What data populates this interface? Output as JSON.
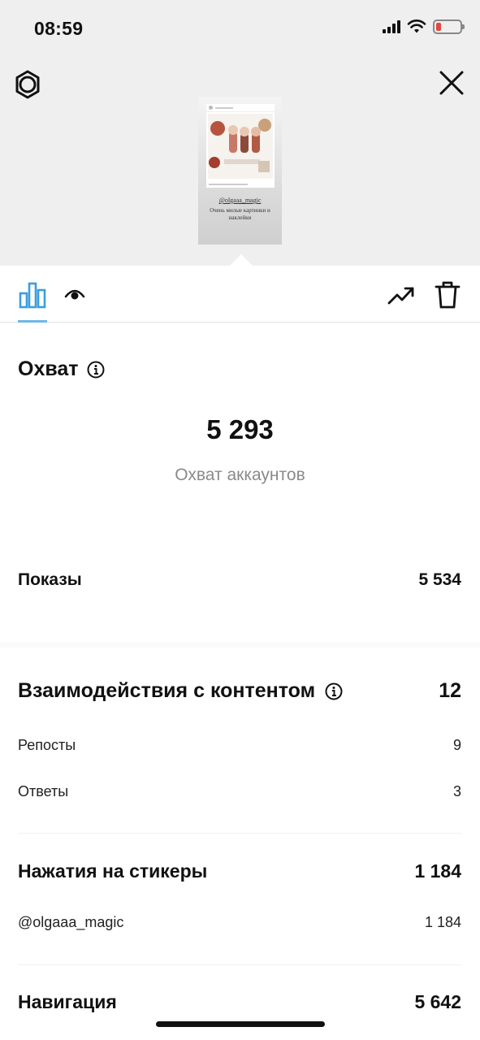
{
  "status": {
    "time": "08:59"
  },
  "preview": {
    "handle": "@olgaaa_magic",
    "caption": "Очень милые картинки и наклейки"
  },
  "reach": {
    "title": "Охват",
    "value": "5 293",
    "label": "Охват аккаунтов"
  },
  "impressions": {
    "label": "Показы",
    "value": "5 534"
  },
  "interactions": {
    "title": "Взаимодействия с контентом",
    "value": "12",
    "items": [
      {
        "label": "Репосты",
        "value": "9"
      },
      {
        "label": "Ответы",
        "value": "3"
      }
    ]
  },
  "sticker_taps": {
    "title": "Нажатия на стикеры",
    "value": "1 184",
    "items": [
      {
        "label": "@olgaaa_magic",
        "value": "1 184"
      }
    ]
  },
  "navigation": {
    "title": "Навигация",
    "value": "5 642"
  },
  "colors": {
    "accent": "#6db8e6",
    "battery_low": "#e5463f",
    "muted_text": "#8a8a8a"
  },
  "icons": [
    "settings-icon",
    "close-icon",
    "stats-tab-icon",
    "views-tab-icon",
    "promote-icon",
    "delete-icon",
    "info-icon"
  ]
}
